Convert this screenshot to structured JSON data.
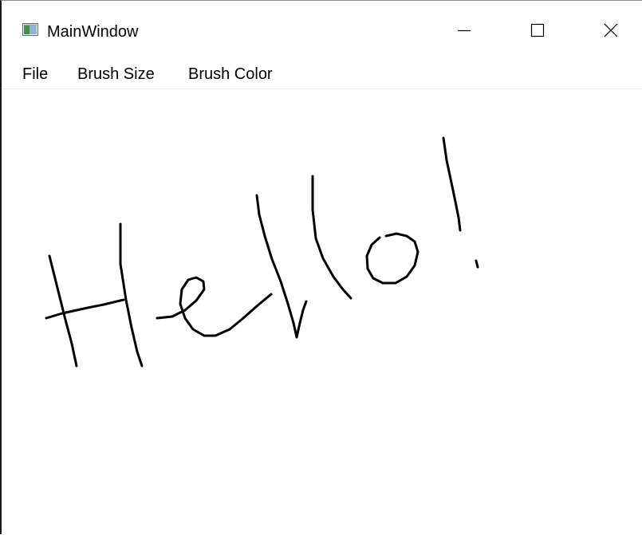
{
  "window": {
    "title": "MainWindow",
    "app_icon": "window-app-icon",
    "controls": {
      "minimize_icon": "minimize-icon",
      "maximize_icon": "maximize-icon",
      "close_icon": "close-icon"
    }
  },
  "menu": {
    "items": [
      {
        "label": "File"
      },
      {
        "label": "Brush Size"
      },
      {
        "label": "Brush Color"
      }
    ]
  },
  "canvas": {
    "background": "#ffffff",
    "stroke_color": "#000000",
    "drawing": "Hello!"
  }
}
